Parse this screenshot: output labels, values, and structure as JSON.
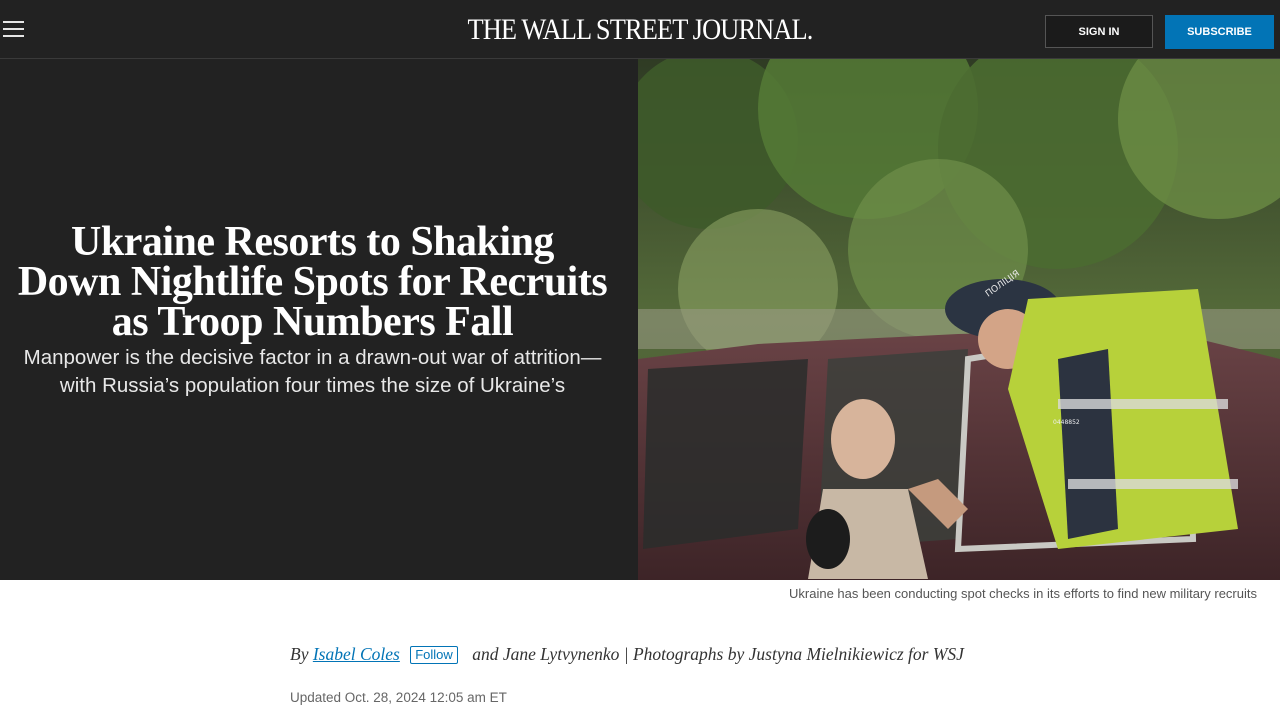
{
  "header": {
    "logo": "THE WALL STREET JOURNAL.",
    "sign_in": "SIGN IN",
    "subscribe": "SUBSCRIBE"
  },
  "article": {
    "headline": "Ukraine Resorts to Shaking Down Nightlife Spots for Recruits as Troop Numbers Fall",
    "dek": "Manpower is the decisive factor in a drawn-out war of attrition—with Russia’s population four times the size of Ukraine’s",
    "photo_caption": "Ukraine has been conducting spot checks in its efforts to find new military recruits",
    "byline": {
      "by": "By",
      "author": "Isabel Coles",
      "follow": "Follow",
      "rest": "and Jane Lytvynenko | Photographs by Justyna Mielnikiewicz for WSJ"
    },
    "updated": "Updated Oct. 28, 2024 12:05 am ET"
  },
  "photo_text": {
    "cap": "ПОЛІЦІЯ",
    "badge": "0448852"
  },
  "colors": {
    "background": "#222222",
    "accent": "#0274b6"
  },
  "icons": {
    "menu": "hamburger-menu-icon"
  }
}
